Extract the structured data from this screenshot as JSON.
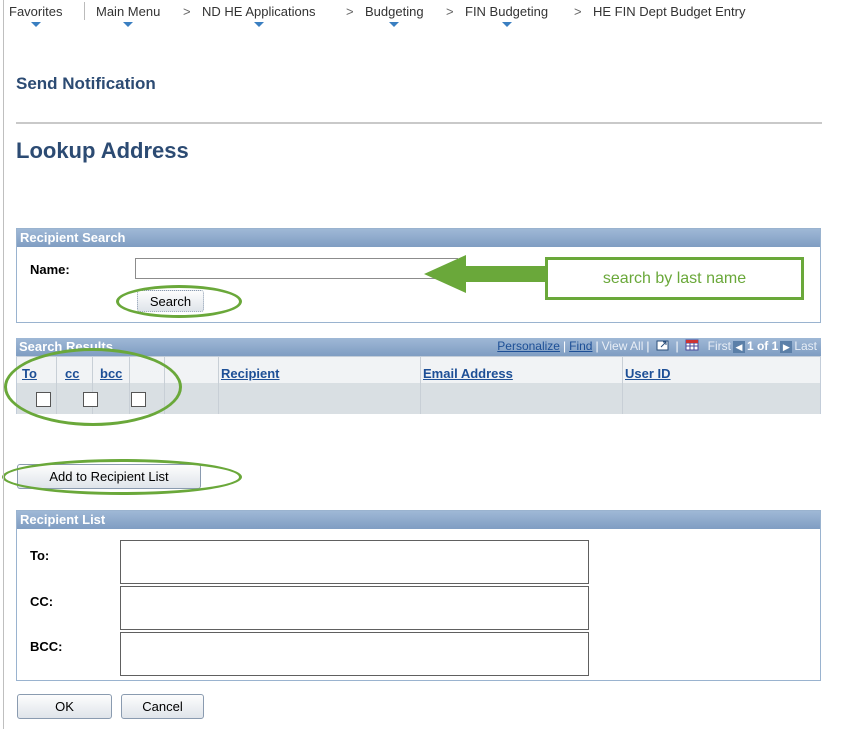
{
  "breadcrumb": {
    "favorites": "Favorites",
    "main_menu": "Main Menu",
    "nd_he_apps": "ND HE Applications",
    "budgeting": "Budgeting",
    "fin_budgeting": "FIN Budgeting",
    "current": "HE FIN Dept Budget Entry",
    "separator": ">"
  },
  "page": {
    "send_title": "Send Notification",
    "lookup_title": "Lookup Address"
  },
  "recipient_search": {
    "header": "Recipient Search",
    "name_label": "Name:",
    "name_value": "",
    "search_button": "Search"
  },
  "annotation": {
    "callout_text": "search by last name",
    "accent_color": "#6aa83a"
  },
  "search_results": {
    "header": "Search Results",
    "personalize": "Personalize",
    "find": "Find",
    "view_all": "View All",
    "first": "First",
    "pagination": "1 of 1",
    "last": "Last",
    "columns": {
      "to": "To",
      "cc": "cc",
      "bcc": "bcc",
      "recipient": "Recipient",
      "email": "Email Address",
      "user_id": "User ID"
    }
  },
  "add_button": "Add to Recipient List",
  "recipient_list": {
    "header": "Recipient List",
    "to_label": "To:",
    "cc_label": "CC:",
    "bcc_label": "BCC:"
  },
  "footer": {
    "ok": "OK",
    "cancel": "Cancel"
  },
  "colors": {
    "header_blue": "#7f9dc2",
    "title_blue": "#2c4b73",
    "link_blue": "#1d4f96"
  }
}
